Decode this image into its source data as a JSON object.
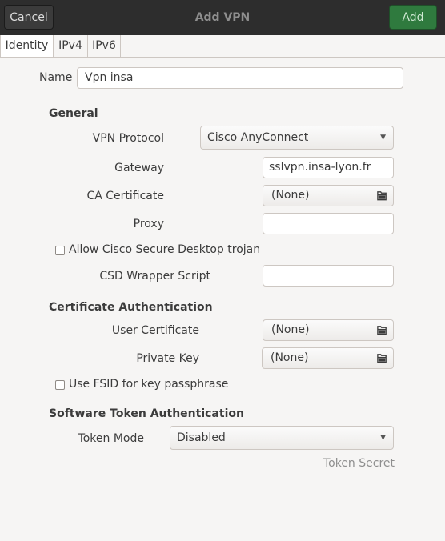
{
  "header": {
    "cancel_label": "Cancel",
    "title": "Add VPN",
    "add_label": "Add",
    "accent_color": "#2f7a3e"
  },
  "tabs": [
    {
      "label": "Identity",
      "active": true
    },
    {
      "label": "IPv4",
      "active": false
    },
    {
      "label": "IPv6",
      "active": false
    }
  ],
  "identity": {
    "name_label": "Name",
    "name_value": "Vpn insa"
  },
  "general": {
    "title": "General",
    "protocol_label": "VPN Protocol",
    "protocol_value": "Cisco AnyConnect",
    "gateway_label": "Gateway",
    "gateway_value": "sslvpn.insa-lyon.fr",
    "ca_label": "CA Certificate",
    "ca_value": "(None)",
    "proxy_label": "Proxy",
    "proxy_value": "",
    "csd_checkbox_label": "Allow Cisco Secure Desktop trojan",
    "csd_checked": false,
    "csd_script_label": "CSD Wrapper Script",
    "csd_script_value": ""
  },
  "cert_auth": {
    "title": "Certificate Authentication",
    "user_cert_label": "User Certificate",
    "user_cert_value": "(None)",
    "private_key_label": "Private Key",
    "private_key_value": "(None)",
    "fsid_checkbox_label": "Use FSID for key passphrase",
    "fsid_checked": false
  },
  "token_auth": {
    "title": "Software Token Authentication",
    "mode_label": "Token Mode",
    "mode_value": "Disabled",
    "secret_label": "Token Secret"
  },
  "icons": {
    "file_chooser": "document-open-icon",
    "dropdown": "chevron-down-icon"
  }
}
